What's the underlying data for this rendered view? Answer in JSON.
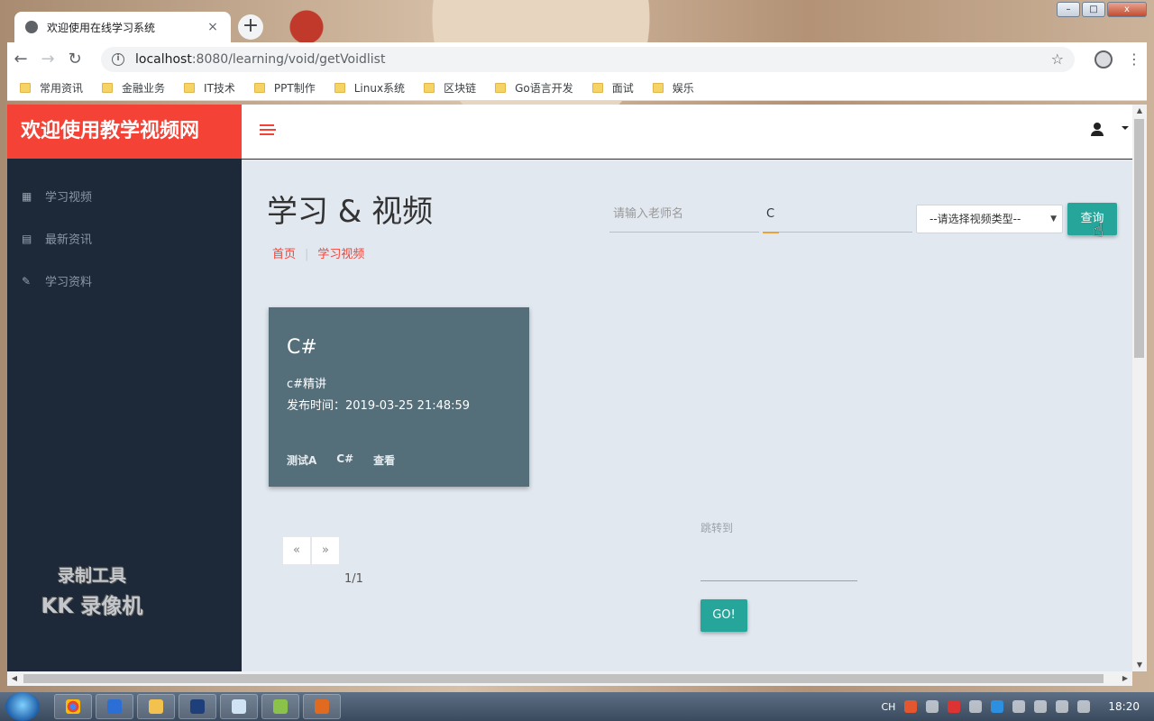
{
  "browser": {
    "tab_title": "欢迎使用在线学习系统",
    "tab_close": "×",
    "new_tab": "+",
    "url_host": "localhost",
    "url_path": ":8080/learning/void/getVoidlist",
    "bookmarks": [
      "常用资讯",
      "金融业务",
      "IT技术",
      "PPT制作",
      "Linux系统",
      "区块链",
      "Go语言开发",
      "面试",
      "娱乐"
    ]
  },
  "app": {
    "brand": "欢迎使用教学视频网",
    "sidebar": [
      {
        "label": "学习视频",
        "icon": "qrcode-icon"
      },
      {
        "label": "最新资讯",
        "icon": "table-icon"
      },
      {
        "label": "学习资料",
        "icon": "edit-icon"
      }
    ],
    "watermark_line1": "录制工具",
    "watermark_line2": "KK 录像机"
  },
  "page": {
    "title": "学习 & 视频",
    "breadcrumb": [
      "首页",
      "学习视频"
    ],
    "teacher_placeholder": "请输入老师名",
    "keyword_value": "C",
    "type_select_value": "--请选择视频类型--",
    "query_label": "查询"
  },
  "videos": [
    {
      "title": "C#",
      "description": "c#精讲",
      "published": "发布时间：2019-03-25 21:48:59",
      "teacher": "测试A",
      "category": "C#",
      "view_label": "查看"
    }
  ],
  "pagination": {
    "prev": "«",
    "next": "»",
    "page_count": "1/1",
    "jump_label": "跳转到",
    "go_label": "GO!"
  },
  "taskbar": {
    "ime": "CH",
    "clock": "18:20"
  }
}
